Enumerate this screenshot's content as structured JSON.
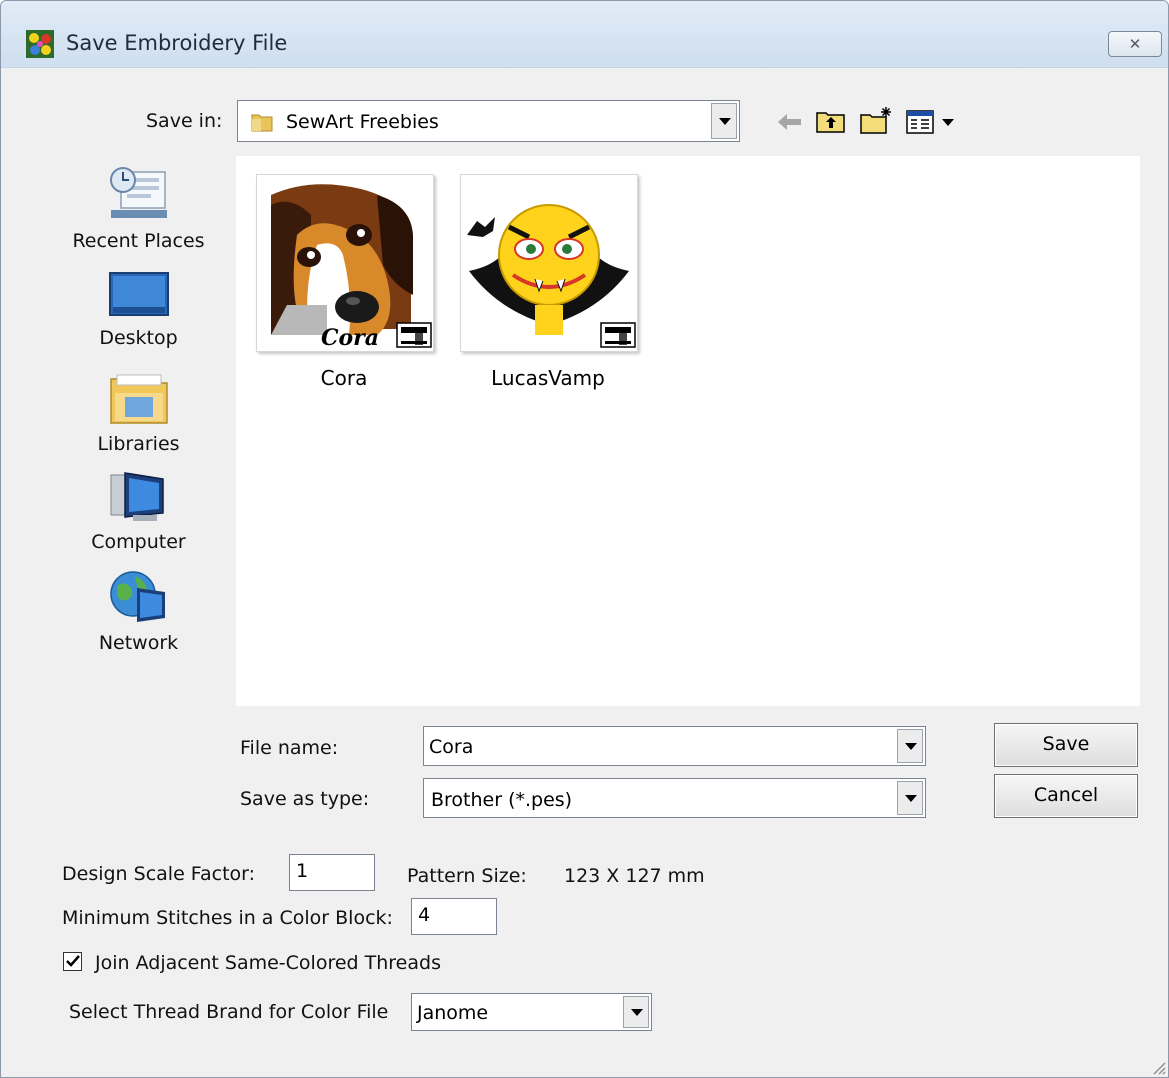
{
  "window": {
    "title": "Save Embroidery File",
    "close_glyph": "✕"
  },
  "save_in": {
    "label": "Save in:",
    "value": "SewArt Freebies"
  },
  "places": [
    {
      "label": "Recent Places",
      "icon": "recent-places-icon"
    },
    {
      "label": "Desktop",
      "icon": "desktop-icon"
    },
    {
      "label": "Libraries",
      "icon": "libraries-icon"
    },
    {
      "label": "Computer",
      "icon": "computer-icon"
    },
    {
      "label": "Network",
      "icon": "network-icon"
    }
  ],
  "files": [
    {
      "name": "Cora",
      "caption": "Cora"
    },
    {
      "name": "LucasVamp"
    }
  ],
  "file_name": {
    "label": "File name:",
    "value": "Cora"
  },
  "save_as_type": {
    "label": "Save as type:",
    "value": "Brother (*.pes)"
  },
  "buttons": {
    "save": "Save",
    "cancel": "Cancel"
  },
  "options": {
    "scale_label": "Design Scale Factor:",
    "scale_value": "1",
    "pattern_size_label": "Pattern Size:",
    "pattern_size_value": "123 X 127 mm",
    "min_stitches_label": "Minimum Stitches in a Color Block:",
    "min_stitches_value": "4",
    "join_label": "Join Adjacent Same-Colored Threads",
    "join_checked": true,
    "thread_brand_label": "Select Thread Brand for Color File",
    "thread_brand_value": "Janome"
  }
}
